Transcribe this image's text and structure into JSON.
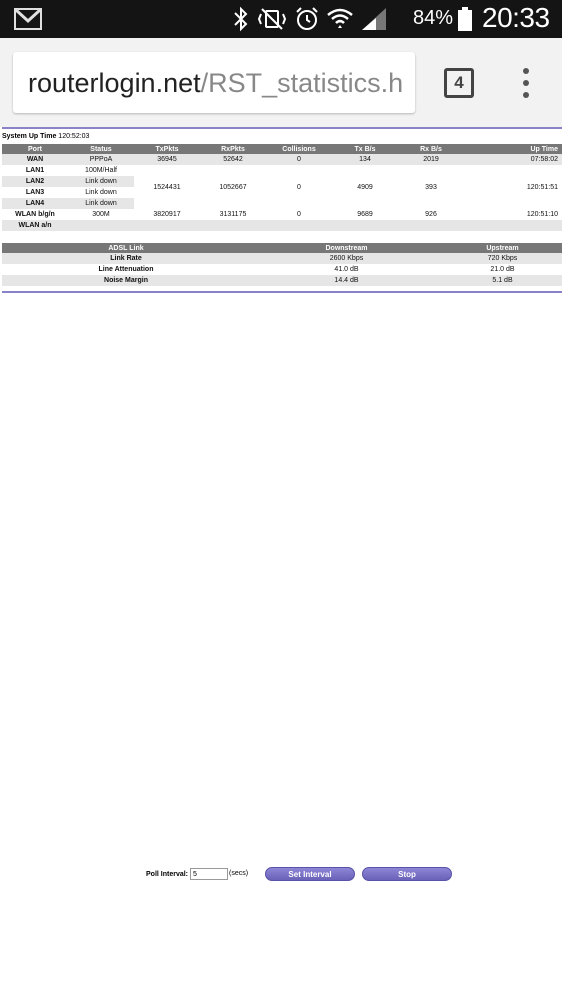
{
  "status_bar": {
    "battery": "84%",
    "time": "20:33"
  },
  "browser": {
    "url_host": "routerlogin.net",
    "url_path": "/RST_statistics.h",
    "tab_count": "4"
  },
  "system_up_time": {
    "label": "System Up Time",
    "value": "120:52:03"
  },
  "port_table": {
    "headers": [
      "Port",
      "Status",
      "TxPkts",
      "RxPkts",
      "Collisions",
      "Tx B/s",
      "Rx B/s",
      "Up Time"
    ],
    "wan": {
      "port": "WAN",
      "status": "PPPoA",
      "tx": "36945",
      "rx": "52642",
      "col": "0",
      "txb": "134",
      "rxb": "2019",
      "up": "07:58:02"
    },
    "lan_ports": [
      {
        "port": "LAN1",
        "status": "100M/Half"
      },
      {
        "port": "LAN2",
        "status": "Link down"
      },
      {
        "port": "LAN3",
        "status": "Link down"
      },
      {
        "port": "LAN4",
        "status": "Link down"
      }
    ],
    "lan_totals": {
      "tx": "1524431",
      "rx": "1052667",
      "col": "0",
      "txb": "4909",
      "rxb": "393",
      "up": "120:51:51"
    },
    "wlan_bgn": {
      "port": "WLAN b/g/n",
      "status": "300M",
      "tx": "3820917",
      "rx": "3131175",
      "col": "0",
      "txb": "9689",
      "rxb": "926",
      "up": "120:51:10"
    },
    "wlan_an": {
      "port": "WLAN a/n"
    }
  },
  "adsl_table": {
    "headers": [
      "ADSL Link",
      "Downstream",
      "Upstream"
    ],
    "rows": [
      {
        "label": "Link Rate",
        "down": "2600 Kbps",
        "up": "720 Kbps"
      },
      {
        "label": "Line Attenuation",
        "down": "41.0 dB",
        "up": "21.0 dB"
      },
      {
        "label": "Noise Margin",
        "down": "14.4 dB",
        "up": "5.1 dB"
      }
    ]
  },
  "poll": {
    "label": "Poll Interval:",
    "value": "5",
    "unit": "(secs)",
    "set_label": "Set Interval",
    "stop_label": "Stop"
  }
}
